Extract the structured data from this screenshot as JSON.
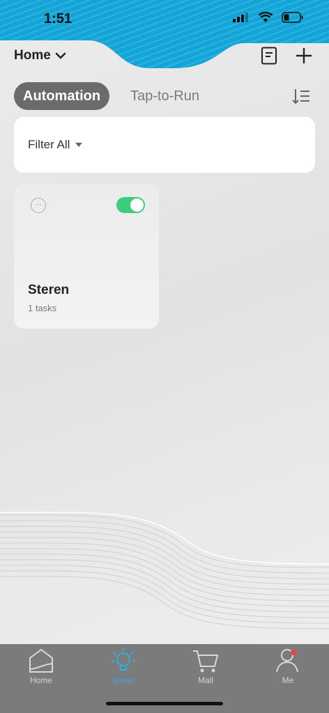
{
  "status_bar": {
    "time": "1:51",
    "icons": [
      "signal-icon",
      "wifi-icon",
      "battery-icon"
    ]
  },
  "header": {
    "title": "Home",
    "icons": [
      "chevron-down-icon",
      "log-icon",
      "add-icon"
    ]
  },
  "tabs": {
    "active": "Automation",
    "inactive": "Tap-to-Run",
    "sort_icon": "sort-icon"
  },
  "filter": {
    "label": "Filter All"
  },
  "scenes": [
    {
      "name": "Steren",
      "tasks": "1 tasks",
      "enabled": true
    }
  ],
  "bottom_nav": [
    {
      "label": "Home",
      "icon": "home-icon",
      "active": false
    },
    {
      "label": "Smart",
      "icon": "bulb-icon",
      "active": true
    },
    {
      "label": "Mall",
      "icon": "cart-icon",
      "active": false
    },
    {
      "label": "Me",
      "icon": "person-icon",
      "active": false,
      "badge": true
    }
  ],
  "colors": {
    "accent": "#3aa9e0",
    "toggle_on": "#3ccd7e",
    "top_wave": "#1fa3d6",
    "tab_bar": "#7b7b7b",
    "badge": "#f04040"
  }
}
